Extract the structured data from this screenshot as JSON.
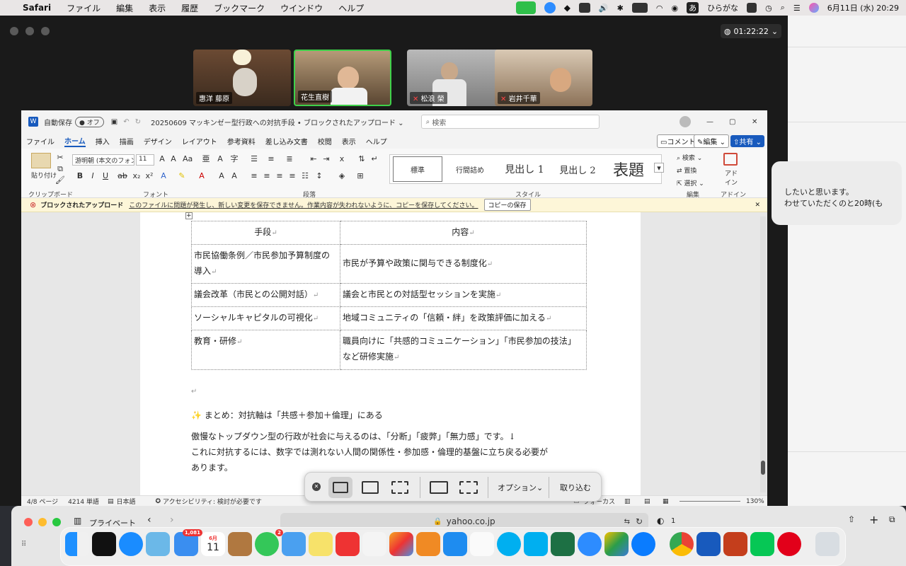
{
  "menubar": {
    "app": "Safari",
    "items": [
      "ファイル",
      "編集",
      "表示",
      "履歴",
      "ブックマーク",
      "ウインドウ",
      "ヘルプ"
    ],
    "ime": "あ",
    "ime_label": "ひらがな",
    "datetime": "6月11日 (水)  20:29"
  },
  "meeting": {
    "timer": "01:22:22",
    "participants": [
      {
        "name": "惠洋 藤原"
      },
      {
        "name": "花生直樹"
      },
      {
        "name": "松浪 榮"
      },
      {
        "name": "岩井千華"
      }
    ]
  },
  "chat": {
    "line1": "したいと思います。",
    "line2": "わせていただくのと20時(も"
  },
  "word": {
    "autosave": "自動保存",
    "autosave_state": "オフ",
    "doc_title": "20250609 マッキンゼー型行政への対抗手段 • ブロックされたアップロード ⌄",
    "search_placeholder": "検索",
    "tabs": [
      "ファイル",
      "ホーム",
      "挿入",
      "描画",
      "デザイン",
      "レイアウト",
      "参考資料",
      "差し込み文書",
      "校閲",
      "表示",
      "ヘルプ"
    ],
    "comment_btn": "コメント",
    "edit_btn": "編集",
    "share_btn": "共有",
    "ribbon": {
      "paste": "貼り付け",
      "font_name": "游明朝 (本文のフォント",
      "font_size": "11",
      "groups": [
        "クリップボード",
        "フォント",
        "段落",
        "スタイル",
        "編集",
        "アドイン"
      ],
      "styles": [
        "標準",
        "行間詰め",
        "見出し 1",
        "見出し 2",
        "表題"
      ],
      "find": "検索",
      "replace": "置換",
      "select": "選択",
      "addin": "アドイン"
    },
    "warning": {
      "title": "ブロックされたアップロード",
      "message": "このファイルに問題が発生し、新しい変更を保存できません。作業内容が失われないように、コピーを保存してください。",
      "button": "コピーの保存"
    },
    "table": {
      "headers": [
        "手段",
        "内容"
      ],
      "rows": [
        [
          "市民協働条例／市民参加予算制度の導入",
          "市民が予算や政策に関与できる制度化"
        ],
        [
          "議会改革（市民との公開対話）",
          "議会と市民との対話型セッションを実施"
        ],
        [
          "ソーシャルキャピタルの可視化",
          "地域コミュニティの「信頼・絆」を政策評価に加える"
        ],
        [
          "教育・研修",
          "職員向けに「共感的コミュニケーション」「市民参加の技法」など研修実施"
        ]
      ]
    },
    "summary": "✨ まとめ：対抗軸は「共感＋参加＋倫理」にある",
    "p1": "傲慢なトップダウン型の行政が社会に与えるのは、「分断」「疲弊」「無力感」です。↓",
    "p2": "これに対抗するには、数字では測れない人間の関係性・参加感・倫理的基盤に立ち戻る必要が",
    "p3": "あります。",
    "status": {
      "page": "4/8 ページ",
      "words": "4214 単語",
      "lang": "日本語",
      "a11y": "アクセシビリティ: 検討が必要です",
      "focus": "フォーカス",
      "zoom": "130%"
    }
  },
  "capture": {
    "options": "オプション",
    "capture": "取り込む"
  },
  "safari": {
    "tab": "プライベート",
    "url": "yahoo.co.jp",
    "tab_count": "1"
  },
  "dock": {
    "mail_badge": "1,081",
    "cal_month": "6月",
    "cal_day": "11",
    "msg_badge": "2"
  }
}
